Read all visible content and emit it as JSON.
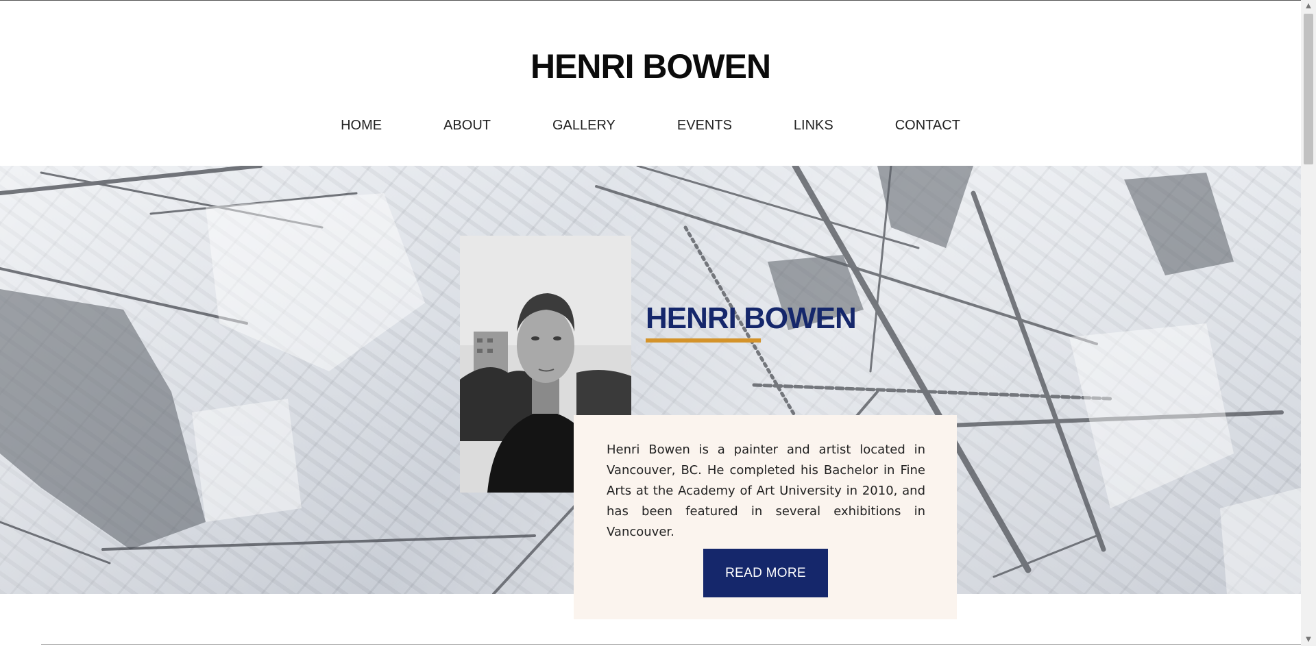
{
  "site": {
    "title": "HENRI BOWEN"
  },
  "nav": {
    "items": [
      "HOME",
      "ABOUT",
      "GALLERY",
      "EVENTS",
      "LINKS",
      "CONTACT"
    ]
  },
  "hero": {
    "name": "HENRI BOWEN",
    "bio": "Henri Bowen is a painter and artist located in Vancouver, BC. He completed his Bachelor in Fine Arts at the Academy of Art University in 2010, and has been featured in several exhibitions in Vancouver.",
    "read_more_label": "READ MORE"
  },
  "colors": {
    "accent": "#15276b",
    "underline": "#d4932a",
    "card": "#fbf4ee"
  },
  "icons": {
    "scroll_up": "chevron-up-icon",
    "scroll_down": "chevron-down-icon"
  }
}
